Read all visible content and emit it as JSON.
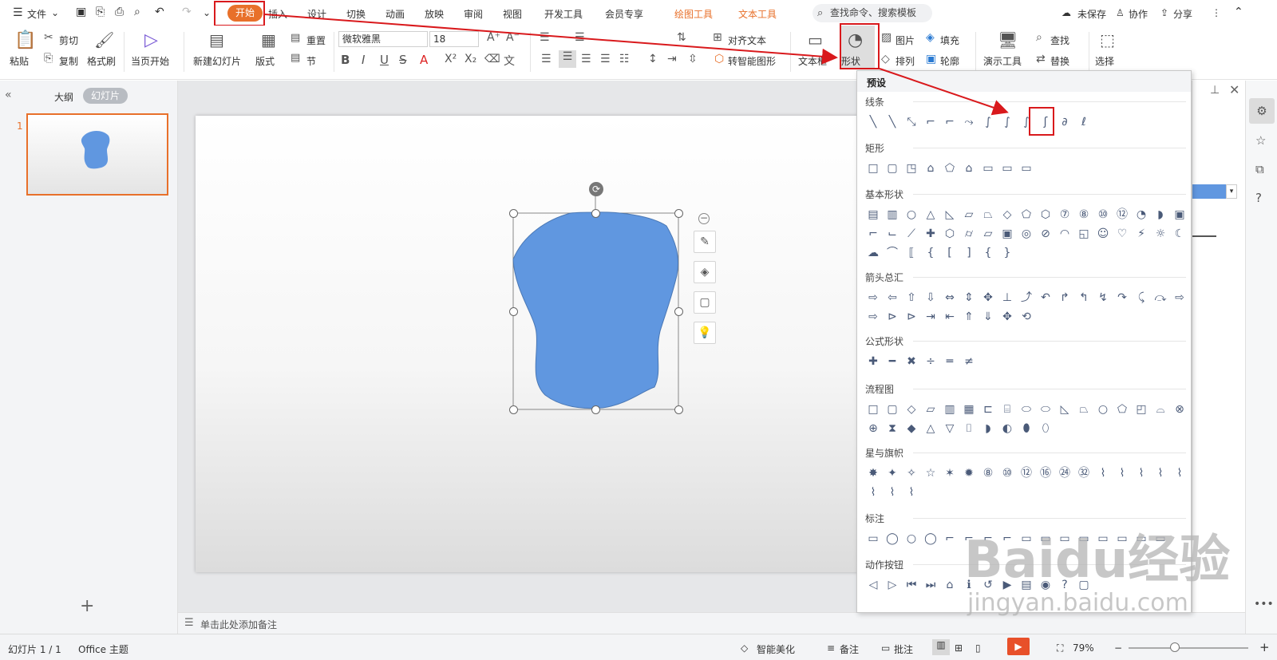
{
  "menubar": {
    "file_label": "文件",
    "tabs": [
      "开始",
      "插入",
      "设计",
      "切换",
      "动画",
      "放映",
      "审阅",
      "视图",
      "开发工具",
      "会员专享",
      "绘图工具",
      "文本工具"
    ],
    "search_placeholder": "查找命令、搜索模板",
    "unsaved": "未保存",
    "collab": "协作",
    "share": "分享"
  },
  "ribbon": {
    "paste": "粘贴",
    "cut": "剪切",
    "copy": "复制",
    "format_painter": "格式刷",
    "from_current": "当页开始",
    "new_slide": "新建幻灯片",
    "layout": "版式",
    "reset": "重置",
    "section": "节",
    "font_name": "微软雅黑",
    "font_size": "18",
    "align_text": "对齐文本",
    "smart_shape": "转智能图形",
    "textbox": "文本框",
    "shape": "形状",
    "picture": "图片",
    "fill": "填充",
    "arrange": "排列",
    "outline": "轮廓",
    "presenter": "演示工具",
    "find": "查找",
    "replace": "替换",
    "select": "选择"
  },
  "leftpanel": {
    "tab_outline": "大纲",
    "tab_slides": "幻灯片",
    "slide_number": "1",
    "add": "+"
  },
  "notes_placeholder": "单击此处添加备注",
  "shapes_panel": {
    "title": "预设",
    "sections": [
      {
        "name": "线条",
        "icons": [
          "╲",
          "╲",
          "⤡",
          "⌐",
          "⌐",
          "⤳",
          "∫",
          "∫",
          "∫",
          "ʃ",
          "∂",
          "ℓ"
        ]
      },
      {
        "name": "矩形",
        "icons": [
          "□",
          "▢",
          "◳",
          "⌂",
          "⬠",
          "⌂",
          "▭",
          "▭",
          "▭"
        ]
      },
      {
        "name": "基本形状",
        "icons": [
          "▤",
          "▥",
          "○",
          "△",
          "◺",
          "▱",
          "⏢",
          "◇",
          "⬠",
          "⬡",
          "⑦",
          "⑧",
          "⑩",
          "⑫",
          "◔",
          "◗",
          "▣",
          "⌐",
          "⌙",
          "⟋",
          "✚",
          "⬡",
          "⌭",
          "▱",
          "▣",
          "◎",
          "⊘",
          "◠",
          "◱",
          "☺",
          "♡",
          "⚡",
          "☼",
          "☾",
          "☁",
          "⌒",
          "⟦",
          "{",
          "[",
          "]",
          "{",
          "}"
        ]
      },
      {
        "name": "箭头总汇",
        "icons": [
          "⇨",
          "⇦",
          "⇧",
          "⇩",
          "⇔",
          "⇕",
          "✥",
          "⊥",
          "⤴",
          "↶",
          "↱",
          "↰",
          "↯",
          "↷",
          "⤹",
          "⤼",
          "⇨",
          "⇨",
          "⊳",
          "⊳",
          "⇥",
          "⇤",
          "⇑",
          "⇓",
          "✥",
          "⟲"
        ]
      },
      {
        "name": "公式形状",
        "icons": [
          "✚",
          "━",
          "✖",
          "÷",
          "═",
          "≠"
        ]
      },
      {
        "name": "流程图",
        "icons": [
          "□",
          "▢",
          "◇",
          "▱",
          "▥",
          "▦",
          "⊏",
          "⌸",
          "⬭",
          "⬭",
          "◺",
          "⏢",
          "○",
          "⬠",
          "◰",
          "⌓",
          "⊗",
          "⊕",
          "⧗",
          "◆",
          "△",
          "▽",
          "⌷",
          "◗",
          "◐",
          "⬮",
          "⬯"
        ]
      },
      {
        "name": "星与旗帜",
        "icons": [
          "✸",
          "✦",
          "✧",
          "☆",
          "✶",
          "✹",
          "⑧",
          "⑩",
          "⑫",
          "⑯",
          "㉔",
          "㉜",
          "⌇",
          "⌇",
          "⌇",
          "⌇",
          "⌇",
          "⌇",
          "⌇",
          "⌇"
        ]
      },
      {
        "name": "标注",
        "icons": [
          "▭",
          "◯",
          "○",
          "◯",
          "⌐",
          "⌐",
          "⌐",
          "⌐",
          "▭",
          "▭",
          "▭",
          "▭",
          "▭",
          "▭",
          "▭",
          "▭"
        ]
      },
      {
        "name": "动作按钮",
        "icons": [
          "◁",
          "▷",
          "⏮",
          "⏭",
          "⌂",
          "ℹ",
          "↺",
          "▶",
          "▤",
          "◉",
          "?",
          "▢"
        ]
      }
    ]
  },
  "status": {
    "slide_info": "幻灯片 1 / 1",
    "theme": "Office 主题",
    "beautify": "智能美化",
    "notes": "备注",
    "comments": "批注",
    "zoom": "79%"
  },
  "watermark": {
    "brand": "Baidu",
    "brand2": "经验",
    "url": "jingyan.baidu.com"
  },
  "colors": {
    "accent": "#e8702a",
    "shape_fill": "#6097e0",
    "highlight": "#d9191c"
  }
}
